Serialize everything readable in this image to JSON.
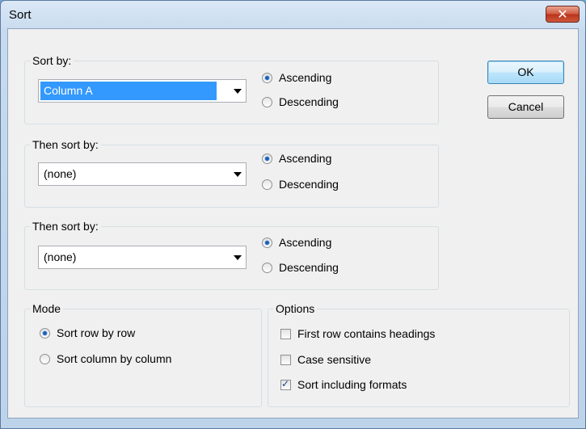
{
  "window": {
    "title": "Sort",
    "close_glyph": "✕"
  },
  "sort_by": {
    "label": "Sort by:",
    "value": "Column A",
    "ascending": "Ascending",
    "descending": "Descending",
    "selected": "ascending"
  },
  "then_by_1": {
    "label": "Then sort by:",
    "value": "(none)",
    "ascending": "Ascending",
    "descending": "Descending",
    "selected": "ascending"
  },
  "then_by_2": {
    "label": "Then sort by:",
    "value": "(none)",
    "ascending": "Ascending",
    "descending": "Descending",
    "selected": "ascending"
  },
  "mode": {
    "label": "Mode",
    "row": "Sort row by row",
    "column": "Sort column by column",
    "selected": "row"
  },
  "options": {
    "label": "Options",
    "headings": "First row contains headings",
    "headings_checked": false,
    "case": "Case sensitive",
    "case_checked": false,
    "formats": "Sort including formats",
    "formats_checked": true
  },
  "buttons": {
    "ok": "OK",
    "cancel": "Cancel"
  },
  "icons": {
    "close": "close-icon",
    "dropdown": "chevron-down-icon"
  }
}
